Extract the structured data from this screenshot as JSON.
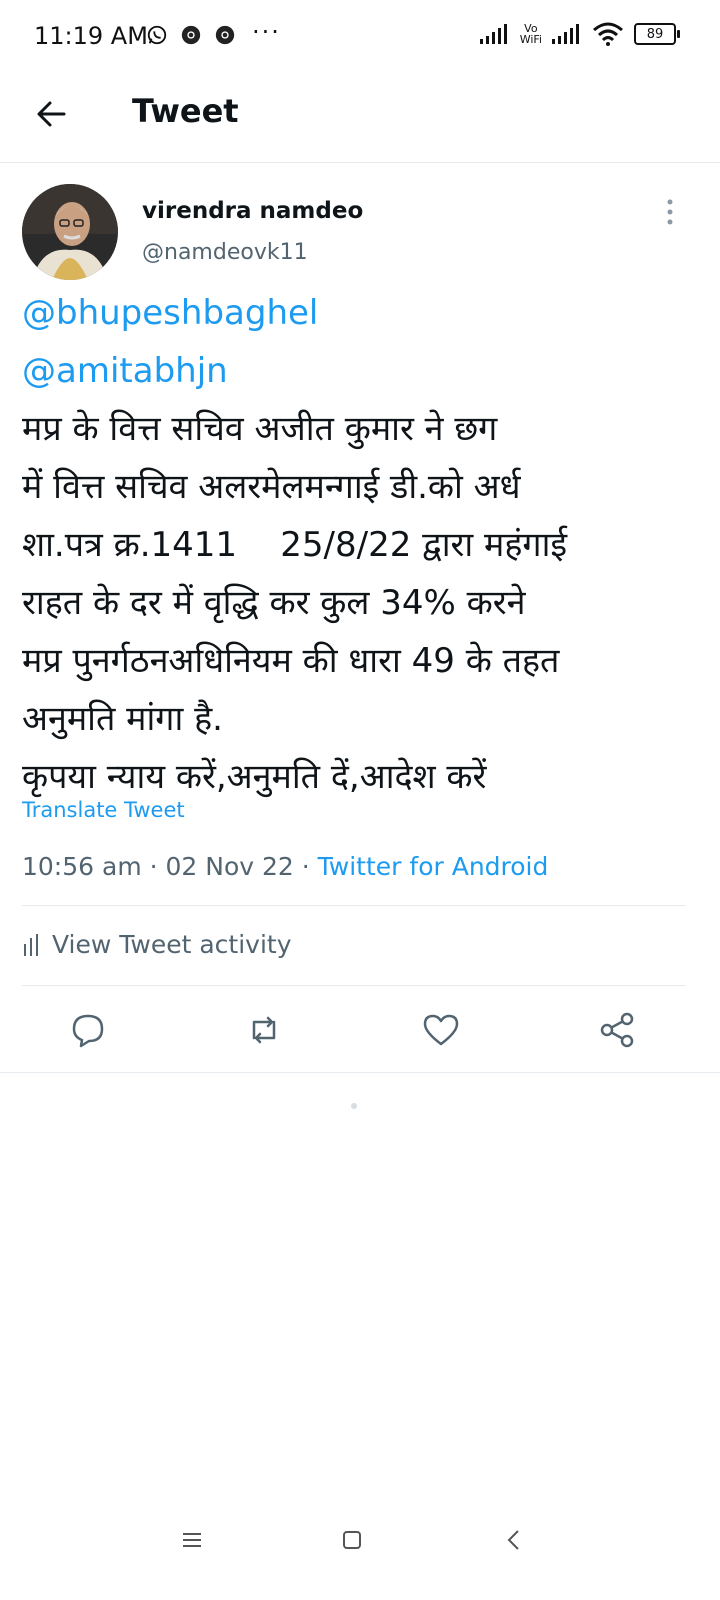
{
  "status_bar": {
    "time": "11:19 AM",
    "extra": "···",
    "vowifi_top": "Vo",
    "vowifi_bottom": "WiFi",
    "battery": "89"
  },
  "header": {
    "title": "Tweet"
  },
  "tweet": {
    "author_name": "virendra namdeo",
    "author_handle": "@namdeovk11",
    "mentions": [
      "@bhupeshbaghel",
      "@amitabhjn"
    ],
    "lines": [
      "मप्र के वित्त सचिव अजीत कुमार ने छग",
      "में वित्त सचिव अलरमेलमन्गाई डी.को अर्ध",
      "शा.पत्र क्र.1411    25/8/22 द्वारा महंगाई",
      "राहत के दर में वृद्धि कर कुल 34% करने",
      "मप्र पुनर्गठनअधिनियम की धारा 49 के तहत",
      "अनुमति मांगा है.",
      "कृपया न्याय करें,अनुमति दें,आदेश करें"
    ],
    "translate_label": "Translate Tweet",
    "time_date": "10:56 am · 02 Nov 22 · ",
    "source": "Twitter for Android",
    "activity_label": "View Tweet activity"
  },
  "colors": {
    "accent": "#1d9bf0",
    "secondary_text": "#536471",
    "divider": "#e6ecf0"
  },
  "icons": {
    "back": "arrow-left-icon",
    "more": "more-vertical-icon",
    "reply": "reply-icon",
    "retweet": "retweet-icon",
    "like": "heart-icon",
    "share": "share-icon"
  }
}
